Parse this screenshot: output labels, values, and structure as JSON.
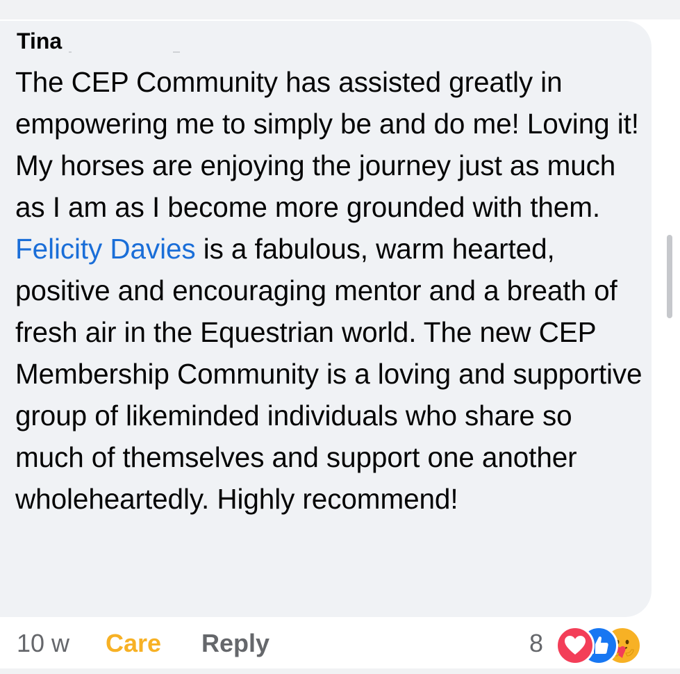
{
  "comment": {
    "author": "Tina",
    "text_before_mention": "The CEP Community has assisted greatly in empowering me to simply be and do me! Loving it! My horses are enjoying the journey just as much as I am as I become more grounded with them. ",
    "mention": "Felicity Davies",
    "text_after_mention": " is a fabulous, warm hearted, positive and encouraging mentor and a breath of fresh air in the Equestrian world. The new CEP Membership Community is a loving and supportive group of likeminded individuals who share so much of themselves and support one another wholeheartedly. Highly recommend!"
  },
  "actions": {
    "timestamp": "10 w",
    "care_label": "Care",
    "reply_label": "Reply",
    "reaction_count": "8"
  },
  "reactions": {
    "icons": [
      "love-icon",
      "like-icon",
      "care-icon"
    ]
  },
  "colors": {
    "bubble": "#f0f2f5",
    "mention": "#1a6ed8",
    "care": "#f7b125",
    "love": "#f33e58",
    "like": "#1877f2",
    "muted": "#65676b"
  }
}
